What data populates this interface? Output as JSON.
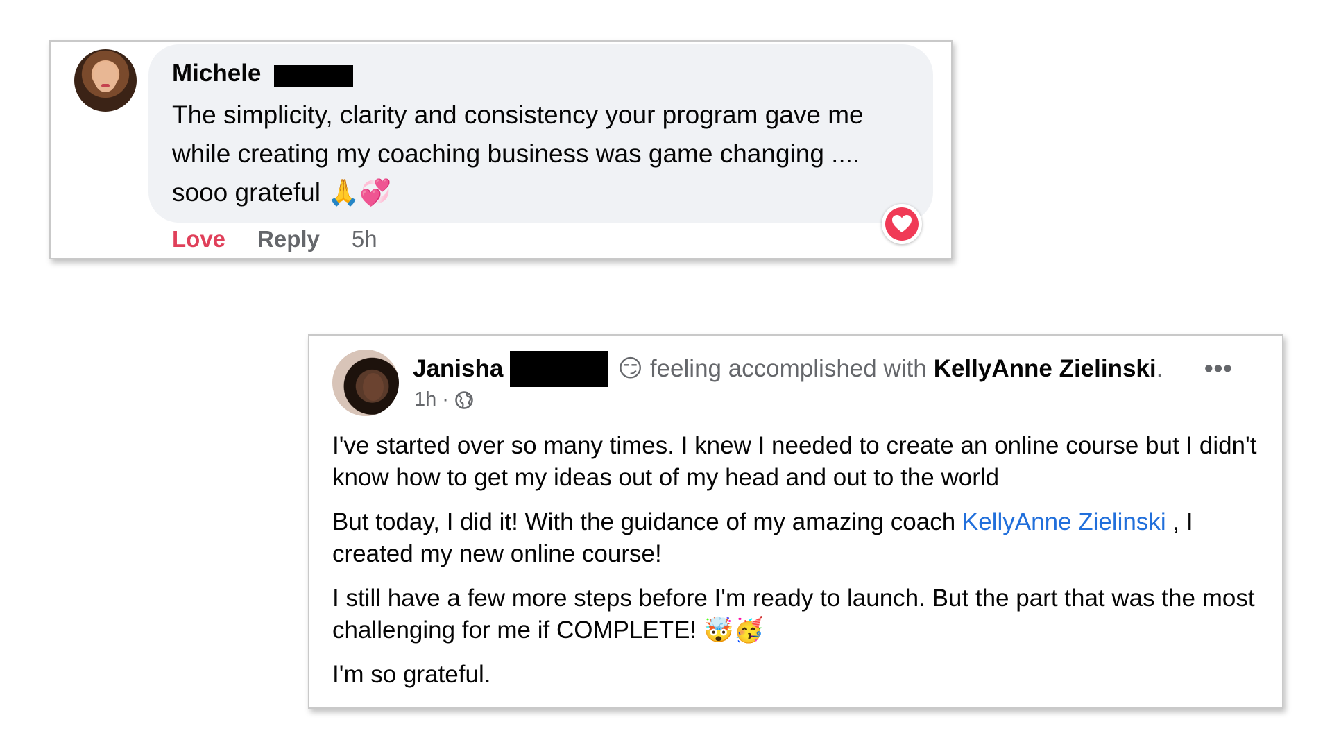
{
  "comment": {
    "author_first_name": "Michele",
    "text": "The simplicity, clarity and consistency your program gave me while creating my coaching business was game changing .... sooo grateful",
    "emojis": "🙏💞",
    "actions": {
      "love_label": "Love",
      "reply_label": "Reply",
      "time": "5h"
    },
    "reaction_icon": "heart-reaction-icon",
    "colors": {
      "bubble": "#f0f2f5",
      "love": "#e0405a",
      "reaction": "#f03a56"
    }
  },
  "post": {
    "author_first_name": "Janisha",
    "feeling_emoji": "😏",
    "feeling_text": "feeling accomplished with",
    "tagged_name": "KellyAnne Zielinski",
    "tagged_suffix": ".",
    "time": "1h",
    "separator": "·",
    "privacy_icon": "globe-icon",
    "more_label": "•••",
    "paragraphs": {
      "p1": "I've started over so many times. I knew I needed to create an online course but I didn't know how to get my ideas out of my head and out to the world",
      "p2_before": "But today, I did it! With the guidance of my amazing coach ",
      "p2_link": "KellyAnne Zielinski",
      "p2_after": " , I created my new online course!",
      "p3": "I still have a few more steps before I'm ready to launch. But the part that was the most challenging for me if COMPLETE!",
      "p3_emojis": "🤯🥳",
      "p4": "I'm so grateful."
    },
    "colors": {
      "link": "#216fdb",
      "meta": "#65676b"
    }
  }
}
